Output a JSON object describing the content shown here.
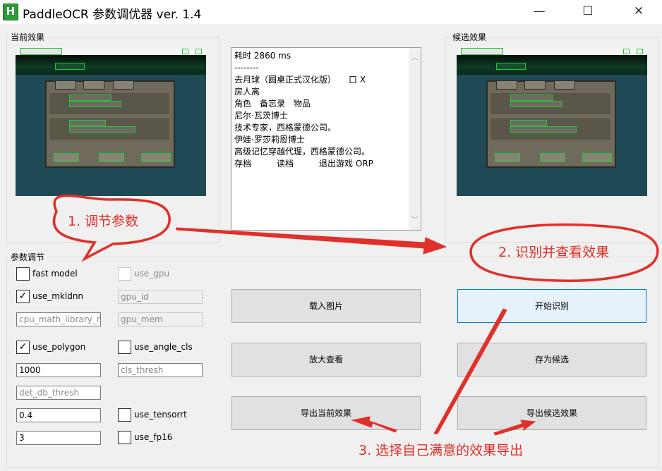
{
  "window": {
    "title": "PaddleOCR 参数调优器 ver. 1.4",
    "app_icon_letter": "H",
    "minimize": "—",
    "maximize": "☐",
    "close": "✕"
  },
  "current_group": {
    "label": "当前效果",
    "thumbnail": {
      "top_label": "人, 评器 4",
      "tabs": [
        "角色",
        "备忘录",
        "物品"
      ],
      "rows": [
        [
          "尼尔·瓦茨博士",
          "技术专家，西格蒙德公司。"
        ],
        [
          "伊娃·罗莎莉恩博士",
          "高级记忆穿越代理，西格蒙德公司。"
        ]
      ],
      "buttons": [
        "存档",
        "读档",
        "退出游戏"
      ]
    }
  },
  "result": {
    "lines": [
      "耗时 2860 ms",
      "--------",
      "去月球（圆桌正式汉化版）　　口 X",
      "房人离",
      "角色　备忘录　物品",
      "尼尔·瓦茨博士",
      "技术专家，西格蒙德公司。",
      "伊娃·罗莎莉恩博士",
      "高级记忆穿越代理，西格蒙德公司。",
      "存档　　　读档　　　退出游戏 ORP"
    ]
  },
  "candidate_group": {
    "label": "候选效果",
    "thumbnail": {
      "top_label": "人, 评器 4",
      "tabs": [
        "角色",
        "备忘录",
        "物品"
      ],
      "rows": [
        [
          "尼尔·瓦茨博士",
          "技术专家，西格蒙德公司。"
        ],
        [
          "伊娃·罗莎莉恩博士",
          "高级记忆穿越代理，西格蒙德公司。"
        ]
      ],
      "buttons": [
        "存档",
        "读档",
        "退出游戏"
      ]
    }
  },
  "params": {
    "label": "参数调节",
    "fast_model": {
      "label": "fast model",
      "checked": false
    },
    "use_gpu": {
      "label": "use_gpu",
      "checked": false,
      "disabled": true
    },
    "use_mkldnn": {
      "label": "use_mkldnn",
      "checked": true
    },
    "gpu_id": "gpu_id",
    "cpu_math_library": "cpu_math_library_nu",
    "gpu_mem": "gpu_mem",
    "use_polygon": {
      "label": "use_polygon",
      "checked": true
    },
    "use_angle_cls": {
      "label": "use_angle_cls",
      "checked": false
    },
    "det_limit": "1000",
    "cls_thresh": "cls_thresh",
    "det_db_thresh": "det_db_thresh",
    "det_value": "0.4",
    "use_tensorrt": {
      "label": "use_tensorrt",
      "checked": false
    },
    "det_count": "3",
    "use_fp16": {
      "label": "use_fp16",
      "checked": false
    }
  },
  "buttons": {
    "load_image": "载入图片",
    "start": "开始识别",
    "zoom": "放大查看",
    "save_candidate": "存为候选",
    "export_current": "导出当前效果",
    "export_candidate": "导出候选效果"
  },
  "annotations": {
    "step1": "1. 调节参数",
    "step2": "2. 识别并查看效果",
    "step3": "3. 选择自己满意的效果导出",
    "color": "#e0302a"
  }
}
